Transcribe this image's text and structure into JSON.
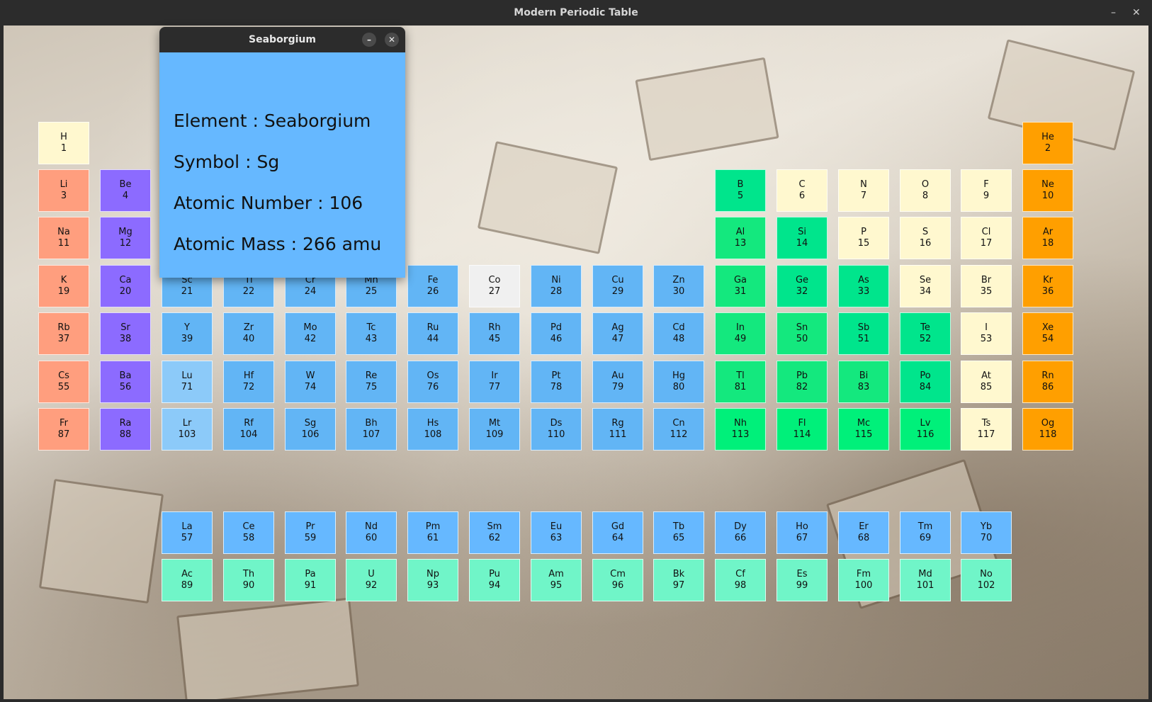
{
  "window": {
    "title": "Modern Periodic Table",
    "minimize": "–",
    "close": "✕"
  },
  "popup": {
    "title": "Seaborgium",
    "minimize": "–",
    "close": "✕",
    "lines": [
      "Element : Seaborgium",
      "Symbol : Sg",
      "Atomic Number : 106",
      "Atomic Mass : 266 amu"
    ]
  },
  "colors": {
    "alkali": "#ff9e7e",
    "alkaline": "#8c6bff",
    "transition": "#62b5f5",
    "lanthanide": "#66b8ff",
    "actinide": "#70f5c8",
    "posttransition": "#18e889",
    "metalloid": "#0ce07e",
    "nonmetal": "#fff8cf",
    "noble": "#ff9f00",
    "unknown": "#00f07a",
    "highlight": "#f0f0f0",
    "light_transition": "#8ccaf9"
  },
  "elements": [
    {
      "symbol": "H",
      "number": "1",
      "color": "#fff8cf",
      "row": 0,
      "col": 0
    },
    {
      "symbol": "He",
      "number": "2",
      "color": "#ff9f00",
      "row": 0,
      "col": 17
    },
    {
      "symbol": "Li",
      "number": "3",
      "color": "#ff9e7e",
      "row": 1,
      "col": 0
    },
    {
      "symbol": "Be",
      "number": "4",
      "color": "#8c6bff",
      "row": 1,
      "col": 1
    },
    {
      "symbol": "B",
      "number": "5",
      "color": "#00e58c",
      "row": 1,
      "col": 12
    },
    {
      "symbol": "C",
      "number": "6",
      "color": "#fff8cf",
      "row": 1,
      "col": 13
    },
    {
      "symbol": "N",
      "number": "7",
      "color": "#fff8cf",
      "row": 1,
      "col": 14
    },
    {
      "symbol": "O",
      "number": "8",
      "color": "#fff8cf",
      "row": 1,
      "col": 15
    },
    {
      "symbol": "F",
      "number": "9",
      "color": "#fff8cf",
      "row": 1,
      "col": 16
    },
    {
      "symbol": "Ne",
      "number": "10",
      "color": "#ff9f00",
      "row": 1,
      "col": 17
    },
    {
      "symbol": "Na",
      "number": "11",
      "color": "#ff9e7e",
      "row": 2,
      "col": 0
    },
    {
      "symbol": "Mg",
      "number": "12",
      "color": "#8c6bff",
      "row": 2,
      "col": 1
    },
    {
      "symbol": "Al",
      "number": "13",
      "color": "#14e87e",
      "row": 2,
      "col": 12
    },
    {
      "symbol": "Si",
      "number": "14",
      "color": "#00e58c",
      "row": 2,
      "col": 13
    },
    {
      "symbol": "P",
      "number": "15",
      "color": "#fff8cf",
      "row": 2,
      "col": 14
    },
    {
      "symbol": "S",
      "number": "16",
      "color": "#fff8cf",
      "row": 2,
      "col": 15
    },
    {
      "symbol": "Cl",
      "number": "17",
      "color": "#fff8cf",
      "row": 2,
      "col": 16
    },
    {
      "symbol": "Ar",
      "number": "18",
      "color": "#ff9f00",
      "row": 2,
      "col": 17
    },
    {
      "symbol": "K",
      "number": "19",
      "color": "#ff9e7e",
      "row": 3,
      "col": 0
    },
    {
      "symbol": "Ca",
      "number": "20",
      "color": "#8c6bff",
      "row": 3,
      "col": 1
    },
    {
      "symbol": "Sc",
      "number": "21",
      "color": "#62b5f5",
      "row": 3,
      "col": 2
    },
    {
      "symbol": "Ti",
      "number": "22",
      "color": "#62b5f5",
      "row": 3,
      "col": 3
    },
    {
      "symbol": "Cr",
      "number": "24",
      "color": "#62b5f5",
      "row": 3,
      "col": 4
    },
    {
      "symbol": "Mn",
      "number": "25",
      "color": "#62b5f5",
      "row": 3,
      "col": 5
    },
    {
      "symbol": "Fe",
      "number": "26",
      "color": "#62b5f5",
      "row": 3,
      "col": 6
    },
    {
      "symbol": "Co",
      "number": "27",
      "color": "#f0f0f0",
      "row": 3,
      "col": 7
    },
    {
      "symbol": "Ni",
      "number": "28",
      "color": "#62b5f5",
      "row": 3,
      "col": 8
    },
    {
      "symbol": "Cu",
      "number": "29",
      "color": "#62b5f5",
      "row": 3,
      "col": 9
    },
    {
      "symbol": "Zn",
      "number": "30",
      "color": "#62b5f5",
      "row": 3,
      "col": 10
    },
    {
      "symbol": "Ga",
      "number": "31",
      "color": "#14e87e",
      "row": 3,
      "col": 12
    },
    {
      "symbol": "Ge",
      "number": "32",
      "color": "#00e58c",
      "row": 3,
      "col": 13
    },
    {
      "symbol": "As",
      "number": "33",
      "color": "#00e58c",
      "row": 3,
      "col": 14
    },
    {
      "symbol": "Se",
      "number": "34",
      "color": "#fff8cf",
      "row": 3,
      "col": 15
    },
    {
      "symbol": "Br",
      "number": "35",
      "color": "#fff8cf",
      "row": 3,
      "col": 16
    },
    {
      "symbol": "Kr",
      "number": "36",
      "color": "#ff9f00",
      "row": 3,
      "col": 17
    },
    {
      "symbol": "Rb",
      "number": "37",
      "color": "#ff9e7e",
      "row": 4,
      "col": 0
    },
    {
      "symbol": "Sr",
      "number": "38",
      "color": "#8c6bff",
      "row": 4,
      "col": 1
    },
    {
      "symbol": "Y",
      "number": "39",
      "color": "#62b5f5",
      "row": 4,
      "col": 2
    },
    {
      "symbol": "Zr",
      "number": "40",
      "color": "#62b5f5",
      "row": 4,
      "col": 3
    },
    {
      "symbol": "Mo",
      "number": "42",
      "color": "#62b5f5",
      "row": 4,
      "col": 4
    },
    {
      "symbol": "Tc",
      "number": "43",
      "color": "#62b5f5",
      "row": 4,
      "col": 5
    },
    {
      "symbol": "Ru",
      "number": "44",
      "color": "#62b5f5",
      "row": 4,
      "col": 6
    },
    {
      "symbol": "Rh",
      "number": "45",
      "color": "#62b5f5",
      "row": 4,
      "col": 7
    },
    {
      "symbol": "Pd",
      "number": "46",
      "color": "#62b5f5",
      "row": 4,
      "col": 8
    },
    {
      "symbol": "Ag",
      "number": "47",
      "color": "#62b5f5",
      "row": 4,
      "col": 9
    },
    {
      "symbol": "Cd",
      "number": "48",
      "color": "#62b5f5",
      "row": 4,
      "col": 10
    },
    {
      "symbol": "In",
      "number": "49",
      "color": "#14e87e",
      "row": 4,
      "col": 12
    },
    {
      "symbol": "Sn",
      "number": "50",
      "color": "#14e87e",
      "row": 4,
      "col": 13
    },
    {
      "symbol": "Sb",
      "number": "51",
      "color": "#00e58c",
      "row": 4,
      "col": 14
    },
    {
      "symbol": "Te",
      "number": "52",
      "color": "#00e58c",
      "row": 4,
      "col": 15
    },
    {
      "symbol": "I",
      "number": "53",
      "color": "#fff8cf",
      "row": 4,
      "col": 16
    },
    {
      "symbol": "Xe",
      "number": "54",
      "color": "#ff9f00",
      "row": 4,
      "col": 17
    },
    {
      "symbol": "Cs",
      "number": "55",
      "color": "#ff9e7e",
      "row": 5,
      "col": 0
    },
    {
      "symbol": "Ba",
      "number": "56",
      "color": "#8c6bff",
      "row": 5,
      "col": 1
    },
    {
      "symbol": "Lu",
      "number": "71",
      "color": "#8ccaf9",
      "row": 5,
      "col": 2
    },
    {
      "symbol": "Hf",
      "number": "72",
      "color": "#62b5f5",
      "row": 5,
      "col": 3
    },
    {
      "symbol": "W",
      "number": "74",
      "color": "#62b5f5",
      "row": 5,
      "col": 4
    },
    {
      "symbol": "Re",
      "number": "75",
      "color": "#62b5f5",
      "row": 5,
      "col": 5
    },
    {
      "symbol": "Os",
      "number": "76",
      "color": "#62b5f5",
      "row": 5,
      "col": 6
    },
    {
      "symbol": "Ir",
      "number": "77",
      "color": "#62b5f5",
      "row": 5,
      "col": 7
    },
    {
      "symbol": "Pt",
      "number": "78",
      "color": "#62b5f5",
      "row": 5,
      "col": 8
    },
    {
      "symbol": "Au",
      "number": "79",
      "color": "#62b5f5",
      "row": 5,
      "col": 9
    },
    {
      "symbol": "Hg",
      "number": "80",
      "color": "#62b5f5",
      "row": 5,
      "col": 10
    },
    {
      "symbol": "Tl",
      "number": "81",
      "color": "#14e87e",
      "row": 5,
      "col": 12
    },
    {
      "symbol": "Pb",
      "number": "82",
      "color": "#14e87e",
      "row": 5,
      "col": 13
    },
    {
      "symbol": "Bi",
      "number": "83",
      "color": "#14e87e",
      "row": 5,
      "col": 14
    },
    {
      "symbol": "Po",
      "number": "84",
      "color": "#00e58c",
      "row": 5,
      "col": 15
    },
    {
      "symbol": "At",
      "number": "85",
      "color": "#fff8cf",
      "row": 5,
      "col": 16
    },
    {
      "symbol": "Rn",
      "number": "86",
      "color": "#ff9f00",
      "row": 5,
      "col": 17
    },
    {
      "symbol": "Fr",
      "number": "87",
      "color": "#ff9e7e",
      "row": 6,
      "col": 0
    },
    {
      "symbol": "Ra",
      "number": "88",
      "color": "#8c6bff",
      "row": 6,
      "col": 1
    },
    {
      "symbol": "Lr",
      "number": "103",
      "color": "#8ccaf9",
      "row": 6,
      "col": 2
    },
    {
      "symbol": "Rf",
      "number": "104",
      "color": "#62b5f5",
      "row": 6,
      "col": 3
    },
    {
      "symbol": "Sg",
      "number": "106",
      "color": "#62b5f5",
      "row": 6,
      "col": 4
    },
    {
      "symbol": "Bh",
      "number": "107",
      "color": "#62b5f5",
      "row": 6,
      "col": 5
    },
    {
      "symbol": "Hs",
      "number": "108",
      "color": "#62b5f5",
      "row": 6,
      "col": 6
    },
    {
      "symbol": "Mt",
      "number": "109",
      "color": "#62b5f5",
      "row": 6,
      "col": 7
    },
    {
      "symbol": "Ds",
      "number": "110",
      "color": "#62b5f5",
      "row": 6,
      "col": 8
    },
    {
      "symbol": "Rg",
      "number": "111",
      "color": "#62b5f5",
      "row": 6,
      "col": 9
    },
    {
      "symbol": "Cn",
      "number": "112",
      "color": "#62b5f5",
      "row": 6,
      "col": 10
    },
    {
      "symbol": "Nh",
      "number": "113",
      "color": "#00f07a",
      "row": 6,
      "col": 12
    },
    {
      "symbol": "Fl",
      "number": "114",
      "color": "#00f07a",
      "row": 6,
      "col": 13
    },
    {
      "symbol": "Mc",
      "number": "115",
      "color": "#00f07a",
      "row": 6,
      "col": 14
    },
    {
      "symbol": "Lv",
      "number": "116",
      "color": "#00f07a",
      "row": 6,
      "col": 15
    },
    {
      "symbol": "Ts",
      "number": "117",
      "color": "#fff8cf",
      "row": 6,
      "col": 16
    },
    {
      "symbol": "Og",
      "number": "118",
      "color": "#ff9f00",
      "row": 6,
      "col": 17
    },
    {
      "symbol": "La",
      "number": "57",
      "color": "#66b8ff",
      "row": 8,
      "col": 2
    },
    {
      "symbol": "Ce",
      "number": "58",
      "color": "#66b8ff",
      "row": 8,
      "col": 3
    },
    {
      "symbol": "Pr",
      "number": "59",
      "color": "#66b8ff",
      "row": 8,
      "col": 4
    },
    {
      "symbol": "Nd",
      "number": "60",
      "color": "#66b8ff",
      "row": 8,
      "col": 5
    },
    {
      "symbol": "Pm",
      "number": "61",
      "color": "#66b8ff",
      "row": 8,
      "col": 6
    },
    {
      "symbol": "Sm",
      "number": "62",
      "color": "#66b8ff",
      "row": 8,
      "col": 7
    },
    {
      "symbol": "Eu",
      "number": "63",
      "color": "#66b8ff",
      "row": 8,
      "col": 8
    },
    {
      "symbol": "Gd",
      "number": "64",
      "color": "#66b8ff",
      "row": 8,
      "col": 9
    },
    {
      "symbol": "Tb",
      "number": "65",
      "color": "#66b8ff",
      "row": 8,
      "col": 10
    },
    {
      "symbol": "Dy",
      "number": "66",
      "color": "#66b8ff",
      "row": 8,
      "col": 11
    },
    {
      "symbol": "Ho",
      "number": "67",
      "color": "#66b8ff",
      "row": 8,
      "col": 12
    },
    {
      "symbol": "Er",
      "number": "68",
      "color": "#66b8ff",
      "row": 8,
      "col": 13
    },
    {
      "symbol": "Tm",
      "number": "69",
      "color": "#66b8ff",
      "row": 8,
      "col": 14
    },
    {
      "symbol": "Yb",
      "number": "70",
      "color": "#66b8ff",
      "row": 8,
      "col": 15
    },
    {
      "symbol": "Ac",
      "number": "89",
      "color": "#70f5c8",
      "row": 9,
      "col": 2
    },
    {
      "symbol": "Th",
      "number": "90",
      "color": "#70f5c8",
      "row": 9,
      "col": 3
    },
    {
      "symbol": "Pa",
      "number": "91",
      "color": "#70f5c8",
      "row": 9,
      "col": 4
    },
    {
      "symbol": "U",
      "number": "92",
      "color": "#70f5c8",
      "row": 9,
      "col": 5
    },
    {
      "symbol": "Np",
      "number": "93",
      "color": "#70f5c8",
      "row": 9,
      "col": 6
    },
    {
      "symbol": "Pu",
      "number": "94",
      "color": "#70f5c8",
      "row": 9,
      "col": 7
    },
    {
      "symbol": "Am",
      "number": "95",
      "color": "#70f5c8",
      "row": 9,
      "col": 8
    },
    {
      "symbol": "Cm",
      "number": "96",
      "color": "#70f5c8",
      "row": 9,
      "col": 9
    },
    {
      "symbol": "Bk",
      "number": "97",
      "color": "#70f5c8",
      "row": 9,
      "col": 10
    },
    {
      "symbol": "Cf",
      "number": "98",
      "color": "#70f5c8",
      "row": 9,
      "col": 11
    },
    {
      "symbol": "Es",
      "number": "99",
      "color": "#70f5c8",
      "row": 9,
      "col": 12
    },
    {
      "symbol": "Fm",
      "number": "100",
      "color": "#70f5c8",
      "row": 9,
      "col": 13
    },
    {
      "symbol": "Md",
      "number": "101",
      "color": "#70f5c8",
      "row": 9,
      "col": 14
    },
    {
      "symbol": "No",
      "number": "102",
      "color": "#70f5c8",
      "row": 9,
      "col": 15
    }
  ]
}
